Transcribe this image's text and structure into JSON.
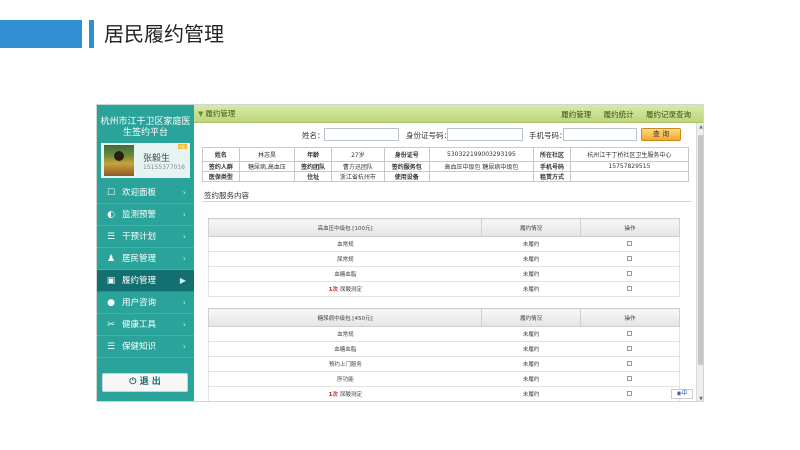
{
  "slide": {
    "title": "居民履约管理"
  },
  "sidebar": {
    "title": "杭州市江干卫区家庭医生签约平台",
    "user": {
      "name": "张毅生",
      "phone": "15155377016",
      "badge": "vip"
    },
    "items": [
      {
        "label": "欢迎面板",
        "icon": "dashboard-icon",
        "glyph": "☐"
      },
      {
        "label": "监测预警",
        "icon": "alert-icon",
        "glyph": "◐"
      },
      {
        "label": "干预计划",
        "icon": "plan-icon",
        "glyph": "☰"
      },
      {
        "label": "居民管理",
        "icon": "residents-icon",
        "glyph": "♟"
      },
      {
        "label": "履约管理",
        "icon": "contract-icon",
        "glyph": "▣"
      },
      {
        "label": "用户咨询",
        "icon": "chat-icon",
        "glyph": "●"
      },
      {
        "label": "健康工具",
        "icon": "tools-icon",
        "glyph": "✂"
      },
      {
        "label": "保健知识",
        "icon": "book-icon",
        "glyph": "☰"
      }
    ],
    "active_index": 4,
    "logout_label": "退 出"
  },
  "topbar": {
    "section": "履约管理",
    "links": [
      "履约管理",
      "履约统计",
      "履约记录查询"
    ]
  },
  "search": {
    "name_label": "姓名：",
    "id_label": "身份证号码：",
    "phone_label": "手机号码：",
    "button": "查 询"
  },
  "info": {
    "rows": [
      [
        "姓名",
        "林志昊",
        "年龄",
        "27岁",
        "身份证号",
        "530322199003293195",
        "所在社区",
        "杭州江干丁桥社区卫生服务中心"
      ],
      [
        "签约人群",
        "糖尿病,高血压",
        "签约团队",
        "曹方迅团队",
        "签约服务包",
        "高血压中级包 糖尿病中级包",
        "手机号码",
        "15757829515"
      ],
      [
        "医保类型",
        "",
        "住址",
        "浙江省杭州市",
        "使用设备",
        "",
        "租赁方式",
        ""
      ]
    ]
  },
  "service": {
    "title": "签约服务内容",
    "packages": [
      {
        "headers": [
          "高血压中级包 [100元]",
          "履约情况",
          "操作"
        ],
        "rows": [
          {
            "count": "",
            "name": "血常规",
            "status": "未履约"
          },
          {
            "count": "",
            "name": "尿常规",
            "status": "未履约"
          },
          {
            "count": "",
            "name": "血糖血脂",
            "status": "未履约"
          },
          {
            "count": "1次",
            "name": "尿酸测定",
            "status": "未履约"
          }
        ]
      },
      {
        "headers": [
          "糖尿病中级包 [450元]",
          "履约情况",
          "操作"
        ],
        "rows": [
          {
            "count": "",
            "name": "血常规",
            "status": "未履约"
          },
          {
            "count": "",
            "name": "血糖血脂",
            "status": "未履约"
          },
          {
            "count": "",
            "name": "预约上门服务",
            "status": "未履约"
          },
          {
            "count": "",
            "name": "肝功能",
            "status": "未履约"
          },
          {
            "count": "1次",
            "name": "尿酸测定",
            "status": "未履约"
          }
        ]
      }
    ]
  },
  "ime": {
    "label": "中"
  }
}
